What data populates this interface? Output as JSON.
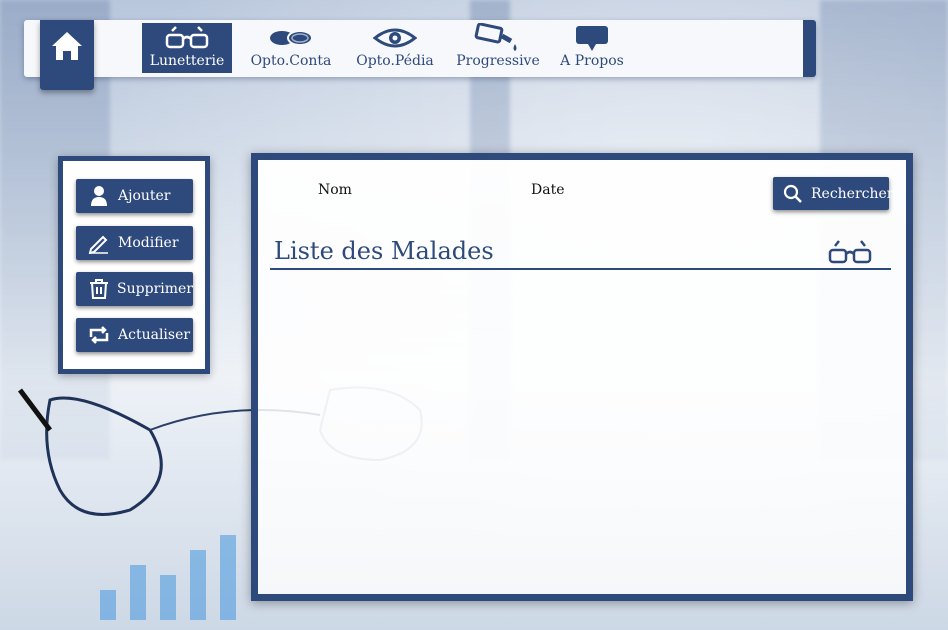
{
  "nav": {
    "home_label": "Home",
    "items": [
      {
        "label": "Lunetterie",
        "icon": "glasses-icon",
        "active": true
      },
      {
        "label": "Opto.Conta",
        "icon": "contact-lens-icon",
        "active": false
      },
      {
        "label": "Opto.Pédia",
        "icon": "eye-icon",
        "active": false
      },
      {
        "label": "Progressive",
        "icon": "eye-drops-icon",
        "active": false
      },
      {
        "label": "A Propos",
        "icon": "speech-bubble-icon",
        "active": false
      }
    ]
  },
  "sidebar": {
    "buttons": [
      {
        "label": "Ajouter",
        "icon": "user-icon"
      },
      {
        "label": "Modifier",
        "icon": "pencil-icon"
      },
      {
        "label": "Supprimer",
        "icon": "trash-icon"
      },
      {
        "label": "Actualiser",
        "icon": "refresh-icon"
      }
    ]
  },
  "main": {
    "columns": {
      "nom": "Nom",
      "date": "Date"
    },
    "search_label": "Rechercher",
    "list_title": "Liste des Malades",
    "list_icon": "glasses-icon"
  },
  "colors": {
    "primary": "#2e4a7d",
    "panel": "#ffffff"
  }
}
